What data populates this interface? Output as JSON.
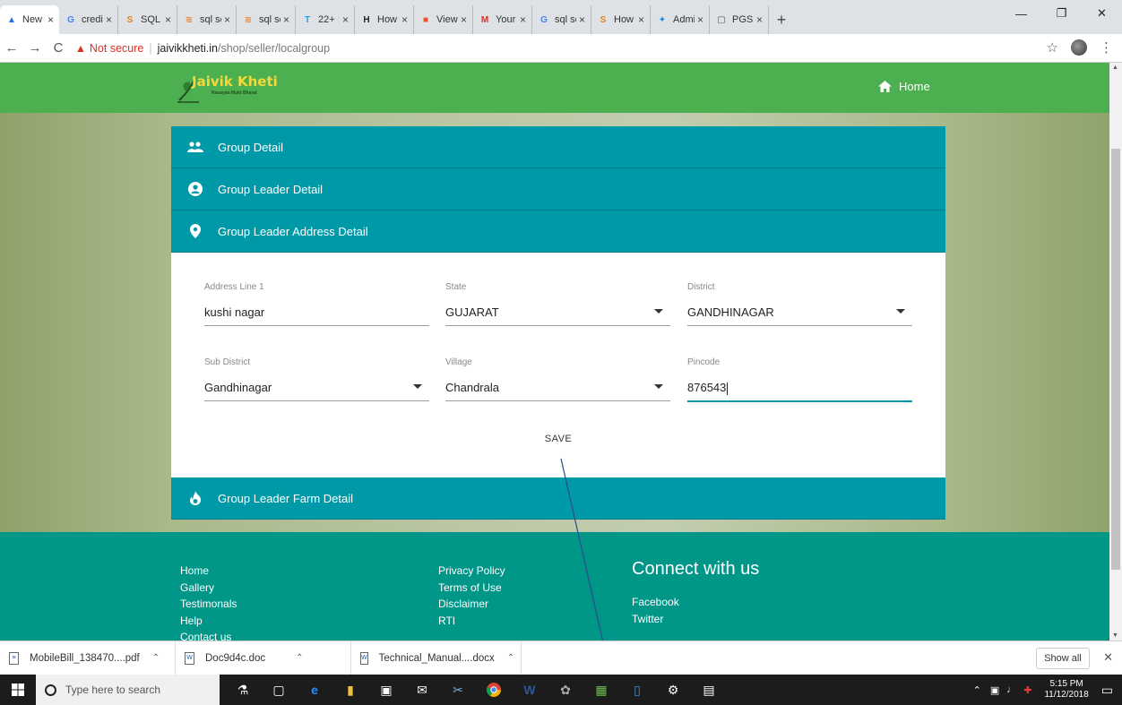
{
  "browser": {
    "tabs": [
      {
        "label": "New",
        "icon": "drive-icon",
        "color": "#1a73e8",
        "glyph": "▲"
      },
      {
        "label": "credit",
        "icon": "google-icon",
        "color": "#4285f4",
        "glyph": "G"
      },
      {
        "label": "SQL",
        "icon": "stackoverflow-icon",
        "color": "#e67e22",
        "glyph": "S"
      },
      {
        "label": "sql se",
        "icon": "stack-icon",
        "color": "#f48024",
        "glyph": "≋"
      },
      {
        "label": "sql se",
        "icon": "stack-icon",
        "color": "#f48024",
        "glyph": "≋"
      },
      {
        "label": "22+",
        "icon": "t-icon",
        "color": "#1da1f2",
        "glyph": "T"
      },
      {
        "label": "How",
        "icon": "htg-icon",
        "color": "#222",
        "glyph": "H"
      },
      {
        "label": "View",
        "icon": "windows-icon",
        "color": "#f25022",
        "glyph": "■"
      },
      {
        "label": "Your",
        "icon": "gmail-icon",
        "color": "#d93025",
        "glyph": "M"
      },
      {
        "label": "sql se",
        "icon": "google-icon",
        "color": "#4285f4",
        "glyph": "G"
      },
      {
        "label": "How",
        "icon": "stackoverflow-icon",
        "color": "#e67e22",
        "glyph": "S"
      },
      {
        "label": "Admi",
        "icon": "admin-icon",
        "color": "#1e88e5",
        "glyph": "✦"
      },
      {
        "label": "PGS",
        "icon": "page-icon",
        "color": "#555",
        "glyph": "▢"
      }
    ],
    "new_tab": "+",
    "back": "←",
    "forward": "→",
    "reload": "C",
    "not_secure": "Not secure",
    "url_host": "jaivikkheti.in",
    "url_path": "/shop/seller/localgroup",
    "bookmark": "☆"
  },
  "site": {
    "logo_title": "Jaivik Kheti",
    "logo_tagline": "Rasayan Mukt Bharat",
    "home_label": "Home"
  },
  "accordion": {
    "sections": {
      "group_detail": "Group Detail",
      "leader_detail": "Group Leader Detail",
      "address_detail": "Group Leader Address Detail",
      "farm_detail": "Group Leader Farm Detail"
    },
    "fields": {
      "address_line1": {
        "label": "Address Line 1",
        "value": "kushi nagar"
      },
      "state": {
        "label": "State",
        "value": "GUJARAT"
      },
      "district": {
        "label": "District",
        "value": "GANDHINAGAR"
      },
      "sub_district": {
        "label": "Sub District",
        "value": "Gandhinagar"
      },
      "village": {
        "label": "Village",
        "value": "Chandrala"
      },
      "pincode": {
        "label": "Pincode",
        "value": "876543"
      }
    },
    "save_label": "SAVE"
  },
  "footer": {
    "col1": [
      "Home",
      "Gallery",
      "Testimonals",
      "Help",
      "Contact us"
    ],
    "col2": [
      "Privacy Policy",
      "Terms of Use",
      "Disclaimer",
      "RTI"
    ],
    "connect_title": "Connect with us",
    "connect_links": [
      "Facebook",
      "Twitter"
    ]
  },
  "downloads": {
    "items": [
      "MobileBill_138470....pdf",
      "Doc9d4c.doc",
      "Technical_Manual....docx"
    ],
    "show_all": "Show all"
  },
  "taskbar": {
    "search_placeholder": "Type here to search",
    "time": "5:15 PM",
    "date": "11/12/2018"
  },
  "colors": {
    "nav_green": "#4caf50",
    "accordion_teal": "#0099a8",
    "footer_teal": "#009688"
  }
}
